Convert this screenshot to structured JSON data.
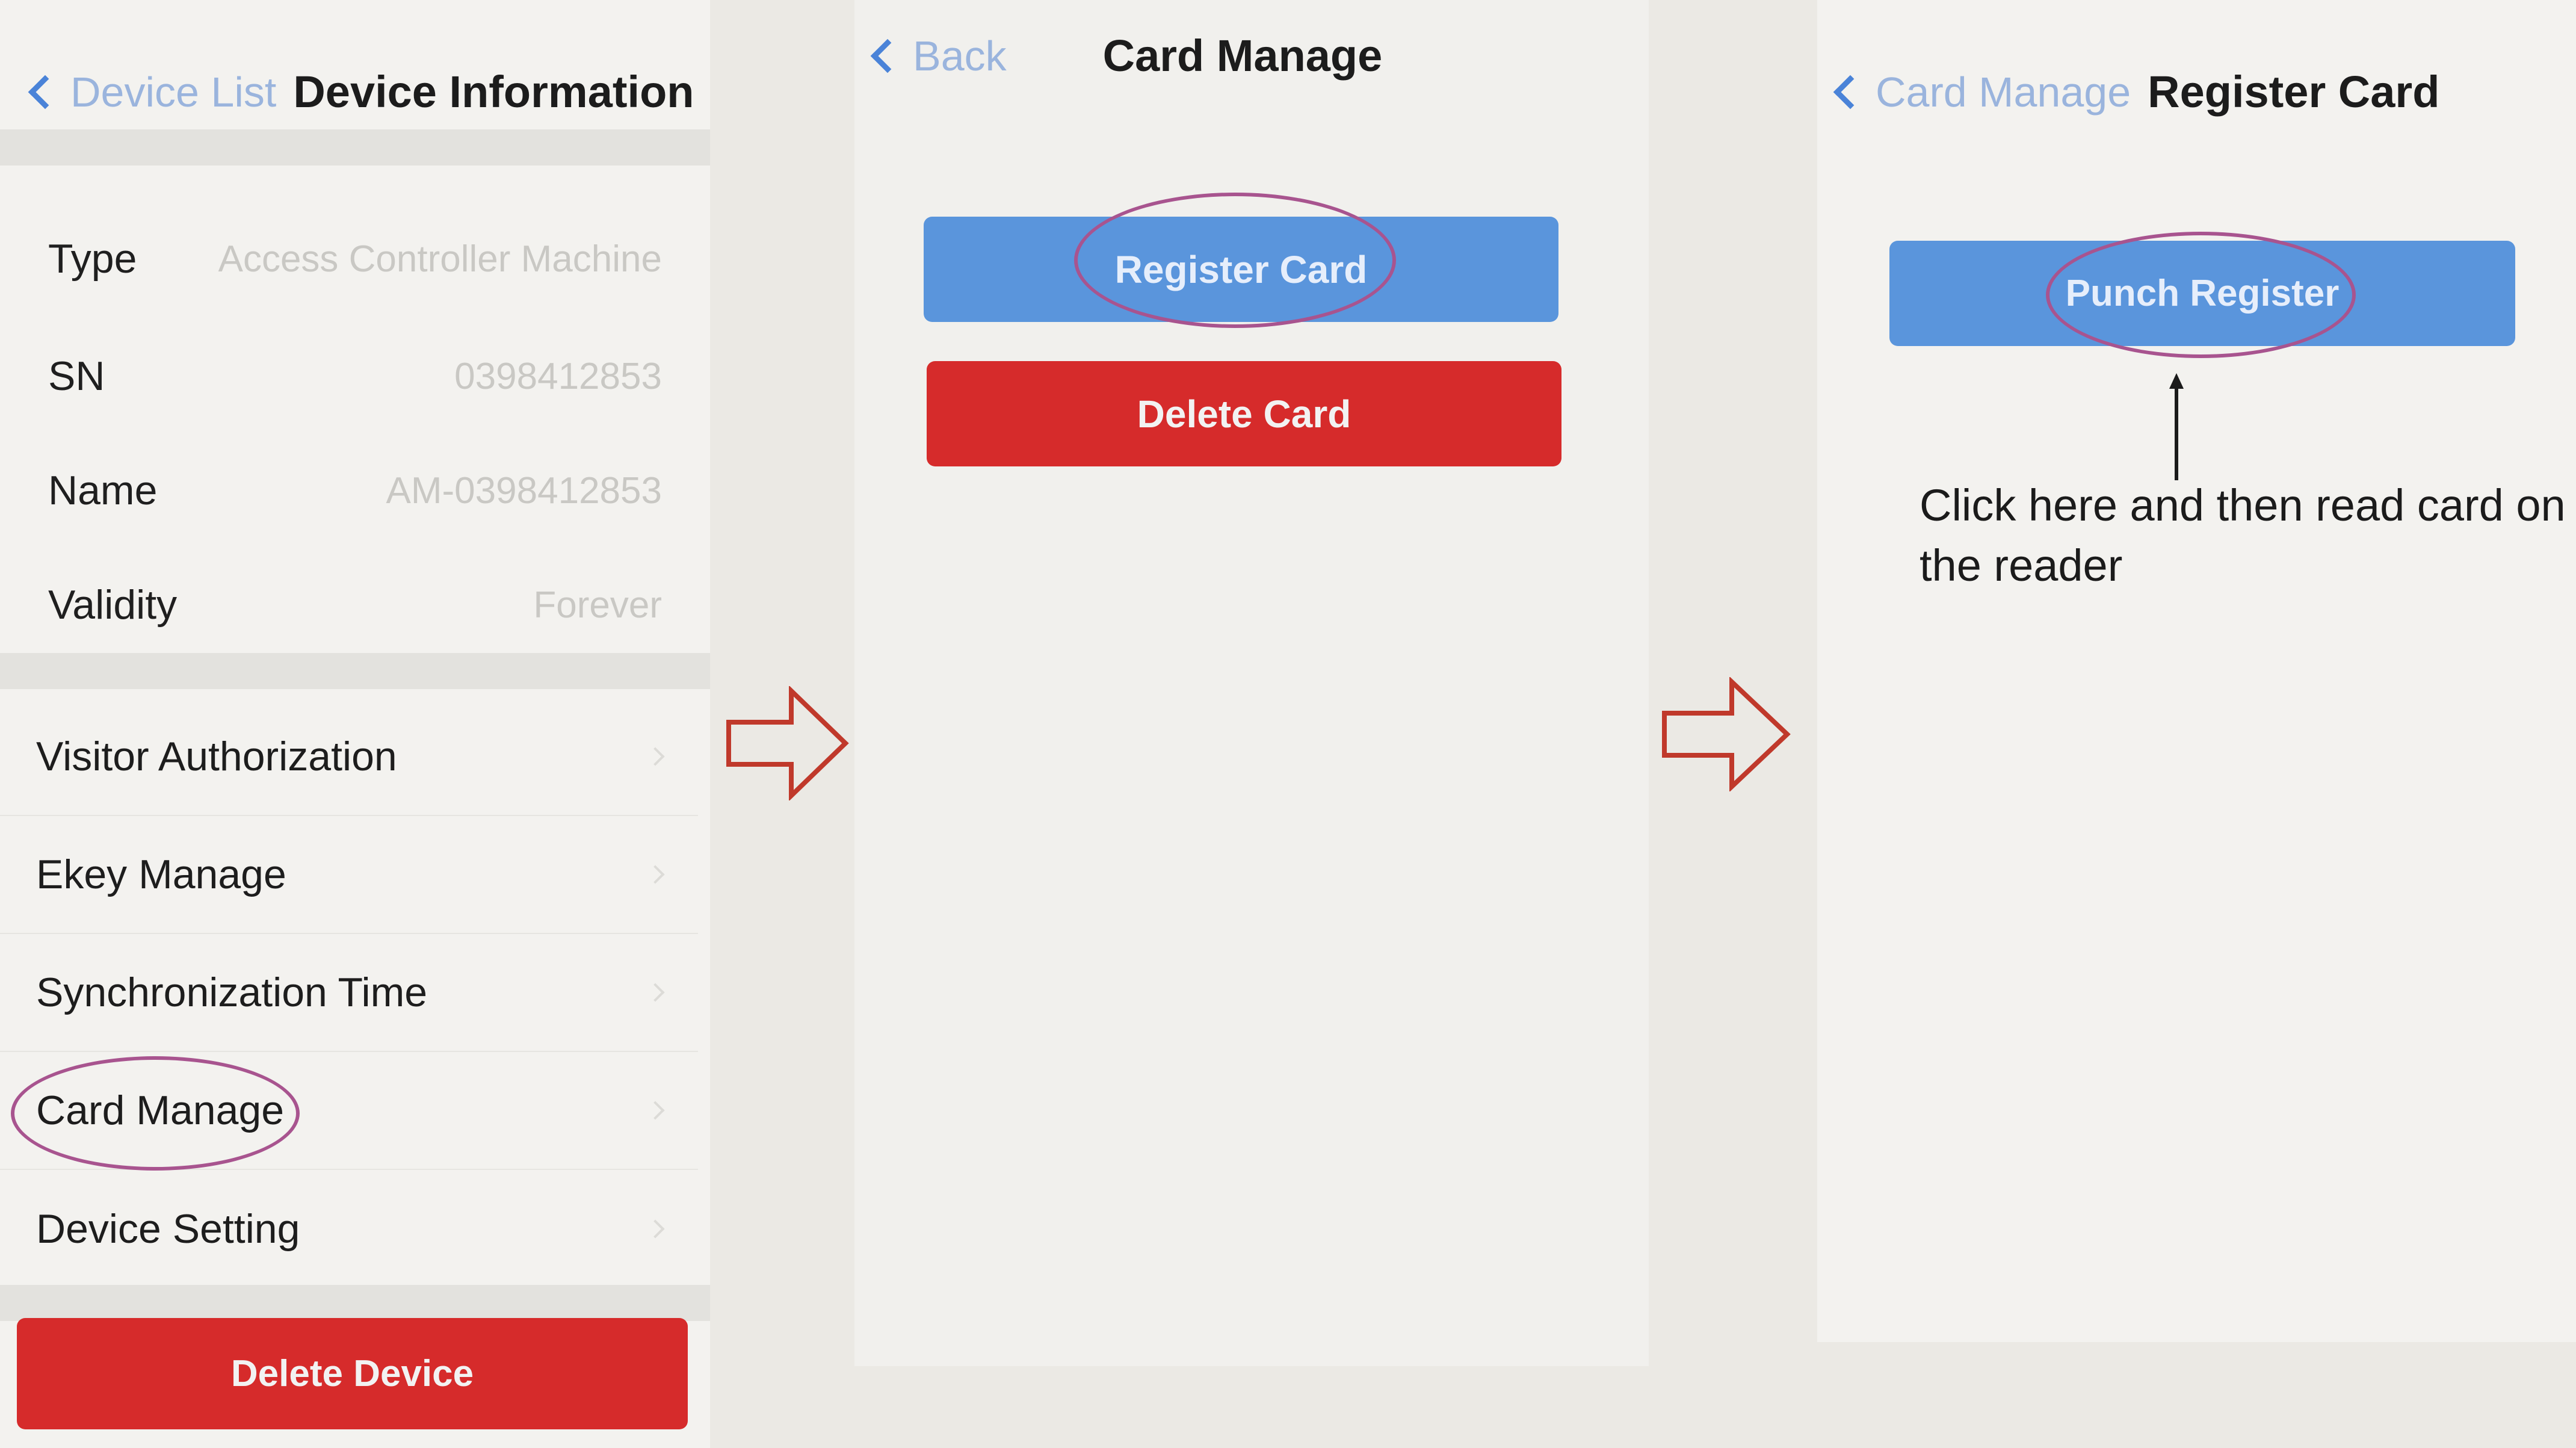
{
  "screen1": {
    "back_label": "Device List",
    "title": "Device Information",
    "info": [
      {
        "label": "Type",
        "value": "Access Controller Machine"
      },
      {
        "label": "SN",
        "value": "0398412853"
      },
      {
        "label": "Name",
        "value": "AM-0398412853"
      },
      {
        "label": "Validity",
        "value": "Forever"
      }
    ],
    "menu": [
      {
        "label": "Visitor Authorization"
      },
      {
        "label": "Ekey Manage"
      },
      {
        "label": "Synchronization Time"
      },
      {
        "label": "Card Manage"
      },
      {
        "label": "Device Setting"
      }
    ],
    "delete_button": "Delete Device"
  },
  "screen2": {
    "back_label": "Back",
    "title": "Card Manage",
    "register_button": "Register Card",
    "delete_button": "Delete Card"
  },
  "screen3": {
    "back_label": "Card Manage",
    "title": "Register Card",
    "punch_button": "Punch Register",
    "annotation": "Click here and then read card on the reader"
  },
  "colors": {
    "accent_blue": "#5a95dc",
    "danger_red": "#d62b2b",
    "highlight": "#a8548f",
    "arrow": "#c0392b"
  },
  "icons": [
    "chevron-left-icon",
    "chevron-right-icon",
    "flow-arrow-icon",
    "pointer-arrow-icon"
  ]
}
